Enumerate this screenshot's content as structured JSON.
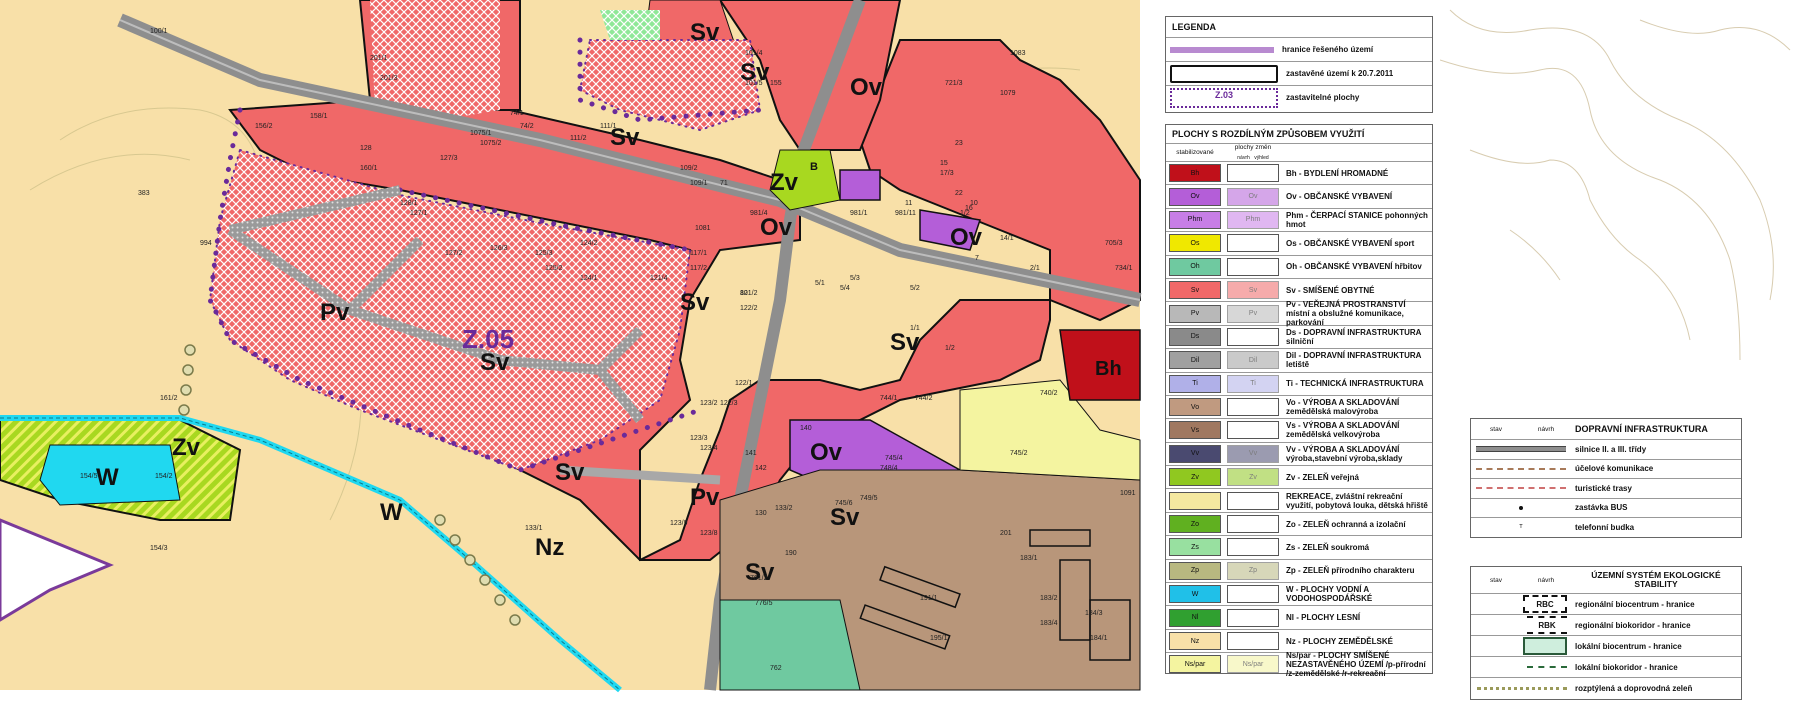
{
  "map_labels": {
    "zones": [
      "Sv",
      "Sv",
      "Sv",
      "Sv",
      "Sv",
      "Sv",
      "Sv",
      "Sv",
      "Sv",
      "Zv",
      "Zv",
      "Ov",
      "Ov",
      "Ov",
      "Ov",
      "Pv",
      "Pv",
      "W",
      "W",
      "Nz",
      "Bh",
      "Z.05",
      "B"
    ],
    "parcels": [
      "100/1",
      "201/1",
      "201/3",
      "156/2",
      "158/1",
      "128",
      "74/1",
      "74/2",
      "1075/1",
      "1075/2",
      "111/1",
      "111/2",
      "160/1",
      "127/3",
      "109/2",
      "109/1",
      "71",
      "128/1",
      "127/1",
      "127/2",
      "126/3",
      "125/3",
      "125/2",
      "124/2",
      "124/1",
      "121/4",
      "117/1",
      "117/2",
      "1081",
      "122/2",
      "121/2",
      "80",
      "1/1",
      "5/2",
      "1/2",
      "5/4",
      "5/3",
      "5/1",
      "1/2",
      "2/1",
      "981/4",
      "981/1",
      "981/11",
      "101/4",
      "101/5",
      "1079",
      "1083",
      "721/3",
      "23",
      "17/3",
      "22",
      "15",
      "11",
      "16",
      "14/1",
      "705/3",
      "734/1",
      "7",
      "10",
      "994",
      "383",
      "161/2",
      "154/5",
      "154/2",
      "154/3",
      "133/1",
      "123/2",
      "123/3",
      "123/4",
      "123/9",
      "123/8",
      "122/1",
      "122/3",
      "141",
      "142",
      "140",
      "748/4",
      "745/4",
      "744/1",
      "744/2",
      "740/2",
      "745/2",
      "749/5",
      "745/6",
      "133/2",
      "130",
      "190",
      "191/1",
      "195/1",
      "183/1",
      "183/2",
      "183/4",
      "184/3",
      "184/1",
      "201",
      "761/2",
      "776/5",
      "762",
      "1091",
      "155"
    ]
  },
  "legend": {
    "title": "LEGENDA",
    "top_items": [
      {
        "label": "hranice řešeného území",
        "symbol": ""
      },
      {
        "label": "zastavěné území k 20.7.2011",
        "symbol": ""
      },
      {
        "label": "zastavitelné plochy",
        "symbol": "Z.03"
      }
    ],
    "uses_title": "PLOCHY S ROZDÍLNÝM ZPŮSOBEM VYUŽITÍ",
    "col_stav": "stabilizované",
    "col_zmena": "plochy změn",
    "col_navrh": "návrh",
    "col_vyhled": "výhled",
    "uses": [
      {
        "code": "Bh",
        "code2": "",
        "label": "Bh - BYDLENÍ HROMADNÉ",
        "color": "#c0101a"
      },
      {
        "code": "Ov",
        "code2": "Ov",
        "label": "Ov - OBČANSKÉ VYBAVENÍ",
        "color": "#b45ed8"
      },
      {
        "code": "Phm",
        "code2": "Phm",
        "label": "Phm - ČERPACÍ STANICE pohonných hmot",
        "color": "#c77ee6"
      },
      {
        "code": "Os",
        "code2": "",
        "label": "Os - OBČANSKÉ VYBAVENÍ sport",
        "color": "#f0e800"
      },
      {
        "code": "Oh",
        "code2": "",
        "label": "Oh - OBČANSKÉ VYBAVENÍ hřbitov",
        "color": "#6fc9a0"
      },
      {
        "code": "Sv",
        "code2": "Sv",
        "label": "Sv - SMÍŠENÉ OBYTNÉ",
        "color": "#f06868"
      },
      {
        "code": "Pv",
        "code2": "Pv",
        "label": "Pv - VEŘEJNÁ PROSTRANSTVÍ místní a obslužné komunikace, parkování",
        "color": "#b8b8b8"
      },
      {
        "code": "Ds",
        "code2": "",
        "label": "Ds - DOPRAVNÍ INFRASTRUKTURA silniční",
        "color": "#8a8a8a"
      },
      {
        "code": "Dil",
        "code2": "Dil",
        "label": "Dil - DOPRAVNÍ INFRASTRUKTURA letiště",
        "color": "#a0a0a0"
      },
      {
        "code": "Ti",
        "code2": "Ti",
        "label": "Ti - TECHNICKÁ INFRASTRUKTURA",
        "color": "#b0b0e8"
      },
      {
        "code": "Vo",
        "code2": "",
        "label": "Vo - VÝROBA A SKLADOVÁNÍ zemědělská malovýroba",
        "color": "#c09a80"
      },
      {
        "code": "Vs",
        "code2": "",
        "label": "Vs - VÝROBA A SKLADOVÁNÍ zemědělská velkovýroba",
        "color": "#a07860"
      },
      {
        "code": "Vv",
        "code2": "Vv",
        "label": "Vv - VÝROBA A SKLADOVÁNÍ výroba,stavební výroba,sklady",
        "color": "#4a4a70"
      },
      {
        "code": "Zv",
        "code2": "Zv",
        "label": "Zv - ZELEŇ veřejná",
        "color": "#90c820"
      },
      {
        "code": "",
        "code2": "",
        "label": "REKREACE, zvláštní rekreační využití, pobytová louka, dětská hřiště",
        "color": "#f4e8a0"
      },
      {
        "code": "Zo",
        "code2": "",
        "label": "Zo - ZELEŇ ochranná a izolační",
        "color": "#60b020"
      },
      {
        "code": "Zs",
        "code2": "",
        "label": "Zs - ZELEŇ soukromá",
        "color": "#98e0a0"
      },
      {
        "code": "Zp",
        "code2": "Zp",
        "label": "Zp - ZELEŇ přírodního charakteru",
        "color": "#b8b880"
      },
      {
        "code": "W",
        "code2": "",
        "label": "W - PLOCHY VODNÍ A VODOHOSPODÁŘSKÉ",
        "color": "#20c0e8"
      },
      {
        "code": "Nl",
        "code2": "",
        "label": "Nl - PLOCHY LESNÍ",
        "color": "#30a030"
      },
      {
        "code": "Nz",
        "code2": "",
        "label": "Nz - PLOCHY ZEMĚDĚLSKÉ",
        "color": "#f8e0a8"
      },
      {
        "code": "Ns/par",
        "code2": "Ns/par",
        "label": "Ns/par - PLOCHY SMÍŠENÉ NEZASTAVĚNÉHO ÚZEMÍ /p-přírodní /z-zemědělské /r-rekreační",
        "color": "#f4f4a0"
      }
    ],
    "transport": {
      "col_stav": "stav",
      "col_navrh": "návrh",
      "title": "DOPRAVNÍ INFRASTRUKTURA",
      "items": [
        "silnice II. a III. třídy",
        "účelové komunikace",
        "turistické trasy",
        "zastávka BUS",
        "telefonní budka"
      ]
    },
    "uses_stability": {
      "col_stav": "stav",
      "col_navrh": "návrh",
      "title": "ÚZEMNÍ SYSTÉM EKOLOGICKÉ STABILITY",
      "items": [
        {
          "symbol": "RBC",
          "label": "regionální biocentrum - hranice"
        },
        {
          "symbol": "RBK",
          "label": "regionální biokoridor - hranice"
        },
        {
          "symbol": "",
          "label": "lokální biocentrum - hranice"
        },
        {
          "symbol": "",
          "label": "lokální biokoridor - hranice"
        },
        {
          "symbol": "",
          "label": "rozptýlená a doprovodná zeleň"
        }
      ]
    }
  },
  "colors": {
    "residential": "#f06868",
    "agri": "#f8e0a8",
    "road": "#8e8e8e",
    "water": "#20d8f0",
    "green": "#a8d820",
    "civic": "#b45ed8",
    "production": "#b8967a",
    "boundary": "#6a2a9a"
  }
}
